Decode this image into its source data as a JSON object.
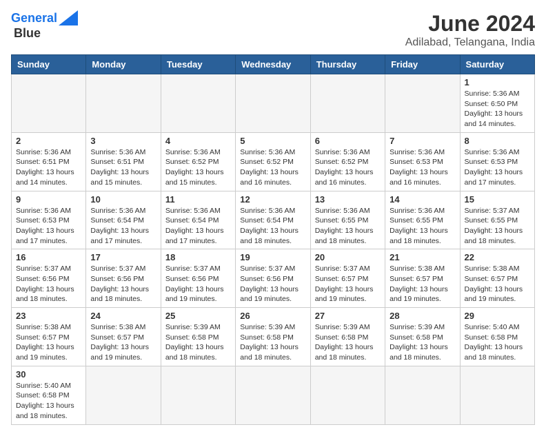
{
  "header": {
    "logo_line1": "General",
    "logo_line2": "Blue",
    "month_year": "June 2024",
    "location": "Adilabad, Telangana, India"
  },
  "days_of_week": [
    "Sunday",
    "Monday",
    "Tuesday",
    "Wednesday",
    "Thursday",
    "Friday",
    "Saturday"
  ],
  "weeks": [
    [
      {
        "day": "",
        "empty": true
      },
      {
        "day": "",
        "empty": true
      },
      {
        "day": "",
        "empty": true
      },
      {
        "day": "",
        "empty": true
      },
      {
        "day": "",
        "empty": true
      },
      {
        "day": "",
        "empty": true
      },
      {
        "day": "1",
        "sunrise": "5:36 AM",
        "sunset": "6:50 PM",
        "daylight": "13 hours and 14 minutes."
      }
    ],
    [
      {
        "day": "2",
        "sunrise": "5:36 AM",
        "sunset": "6:51 PM",
        "daylight": "13 hours and 14 minutes."
      },
      {
        "day": "3",
        "sunrise": "5:36 AM",
        "sunset": "6:51 PM",
        "daylight": "13 hours and 15 minutes."
      },
      {
        "day": "4",
        "sunrise": "5:36 AM",
        "sunset": "6:52 PM",
        "daylight": "13 hours and 15 minutes."
      },
      {
        "day": "5",
        "sunrise": "5:36 AM",
        "sunset": "6:52 PM",
        "daylight": "13 hours and 16 minutes."
      },
      {
        "day": "6",
        "sunrise": "5:36 AM",
        "sunset": "6:52 PM",
        "daylight": "13 hours and 16 minutes."
      },
      {
        "day": "7",
        "sunrise": "5:36 AM",
        "sunset": "6:53 PM",
        "daylight": "13 hours and 16 minutes."
      },
      {
        "day": "8",
        "sunrise": "5:36 AM",
        "sunset": "6:53 PM",
        "daylight": "13 hours and 17 minutes."
      }
    ],
    [
      {
        "day": "9",
        "sunrise": "5:36 AM",
        "sunset": "6:53 PM",
        "daylight": "13 hours and 17 minutes."
      },
      {
        "day": "10",
        "sunrise": "5:36 AM",
        "sunset": "6:54 PM",
        "daylight": "13 hours and 17 minutes."
      },
      {
        "day": "11",
        "sunrise": "5:36 AM",
        "sunset": "6:54 PM",
        "daylight": "13 hours and 17 minutes."
      },
      {
        "day": "12",
        "sunrise": "5:36 AM",
        "sunset": "6:54 PM",
        "daylight": "13 hours and 18 minutes."
      },
      {
        "day": "13",
        "sunrise": "5:36 AM",
        "sunset": "6:55 PM",
        "daylight": "13 hours and 18 minutes."
      },
      {
        "day": "14",
        "sunrise": "5:36 AM",
        "sunset": "6:55 PM",
        "daylight": "13 hours and 18 minutes."
      },
      {
        "day": "15",
        "sunrise": "5:37 AM",
        "sunset": "6:55 PM",
        "daylight": "13 hours and 18 minutes."
      }
    ],
    [
      {
        "day": "16",
        "sunrise": "5:37 AM",
        "sunset": "6:56 PM",
        "daylight": "13 hours and 18 minutes."
      },
      {
        "day": "17",
        "sunrise": "5:37 AM",
        "sunset": "6:56 PM",
        "daylight": "13 hours and 18 minutes."
      },
      {
        "day": "18",
        "sunrise": "5:37 AM",
        "sunset": "6:56 PM",
        "daylight": "13 hours and 19 minutes."
      },
      {
        "day": "19",
        "sunrise": "5:37 AM",
        "sunset": "6:56 PM",
        "daylight": "13 hours and 19 minutes."
      },
      {
        "day": "20",
        "sunrise": "5:37 AM",
        "sunset": "6:57 PM",
        "daylight": "13 hours and 19 minutes."
      },
      {
        "day": "21",
        "sunrise": "5:38 AM",
        "sunset": "6:57 PM",
        "daylight": "13 hours and 19 minutes."
      },
      {
        "day": "22",
        "sunrise": "5:38 AM",
        "sunset": "6:57 PM",
        "daylight": "13 hours and 19 minutes."
      }
    ],
    [
      {
        "day": "23",
        "sunrise": "5:38 AM",
        "sunset": "6:57 PM",
        "daylight": "13 hours and 19 minutes."
      },
      {
        "day": "24",
        "sunrise": "5:38 AM",
        "sunset": "6:57 PM",
        "daylight": "13 hours and 19 minutes."
      },
      {
        "day": "25",
        "sunrise": "5:39 AM",
        "sunset": "6:58 PM",
        "daylight": "13 hours and 18 minutes."
      },
      {
        "day": "26",
        "sunrise": "5:39 AM",
        "sunset": "6:58 PM",
        "daylight": "13 hours and 18 minutes."
      },
      {
        "day": "27",
        "sunrise": "5:39 AM",
        "sunset": "6:58 PM",
        "daylight": "13 hours and 18 minutes."
      },
      {
        "day": "28",
        "sunrise": "5:39 AM",
        "sunset": "6:58 PM",
        "daylight": "13 hours and 18 minutes."
      },
      {
        "day": "29",
        "sunrise": "5:40 AM",
        "sunset": "6:58 PM",
        "daylight": "13 hours and 18 minutes."
      }
    ],
    [
      {
        "day": "30",
        "sunrise": "5:40 AM",
        "sunset": "6:58 PM",
        "daylight": "13 hours and 18 minutes."
      },
      {
        "day": "",
        "empty": true
      },
      {
        "day": "",
        "empty": true
      },
      {
        "day": "",
        "empty": true
      },
      {
        "day": "",
        "empty": true
      },
      {
        "day": "",
        "empty": true
      },
      {
        "day": "",
        "empty": true
      }
    ]
  ]
}
